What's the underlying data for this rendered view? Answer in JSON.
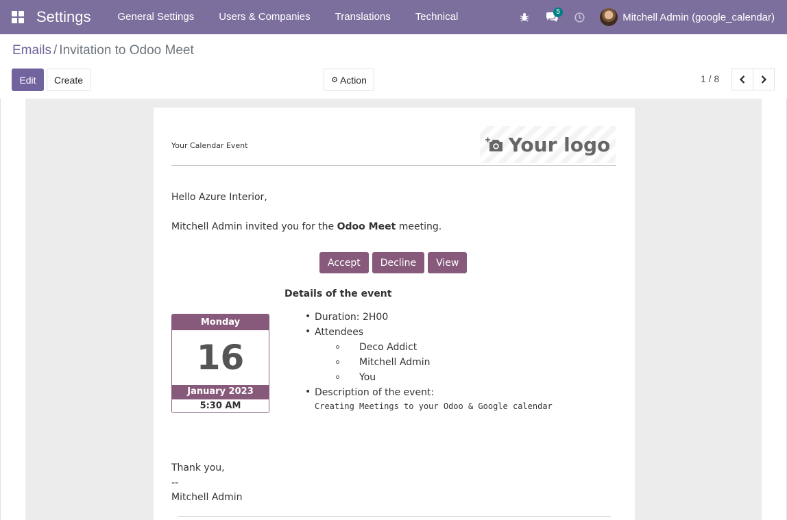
{
  "navbar": {
    "app_title": "Settings",
    "menu": [
      "General Settings",
      "Users & Companies",
      "Translations",
      "Technical"
    ],
    "messages_count": "5",
    "user_name": "Mitchell Admin (google_calendar)"
  },
  "breadcrumb": {
    "parent": "Emails",
    "separator": "/",
    "current": "Invitation to Odoo Meet"
  },
  "control_panel": {
    "edit_label": "Edit",
    "create_label": "Create",
    "action_label": "Action",
    "pager": "1 / 8"
  },
  "email": {
    "header_label": "Your Calendar Event",
    "logo_text": "Your logo",
    "greeting": "Hello Azure Interior,",
    "invite_prefix": "Mitchell Admin invited you for the ",
    "invite_event": "Odoo Meet",
    "invite_suffix": " meeting.",
    "buttons": [
      "Accept",
      "Decline",
      "View"
    ],
    "details_title": "Details of the event",
    "calendar": {
      "weekday": "Monday",
      "day": "16",
      "month_year": "January 2023",
      "time": "5:30 AM"
    },
    "duration": "Duration: 2H00",
    "attendees_label": "Attendees",
    "attendees": [
      "Deco Addict",
      "Mitchell Admin",
      "You"
    ],
    "description_label": "Description of the event:",
    "description": "Creating Meetings to your Odoo & Google calendar",
    "thanks": "Thank you,",
    "signature_sep": "--",
    "signature": "Mitchell Admin"
  }
}
